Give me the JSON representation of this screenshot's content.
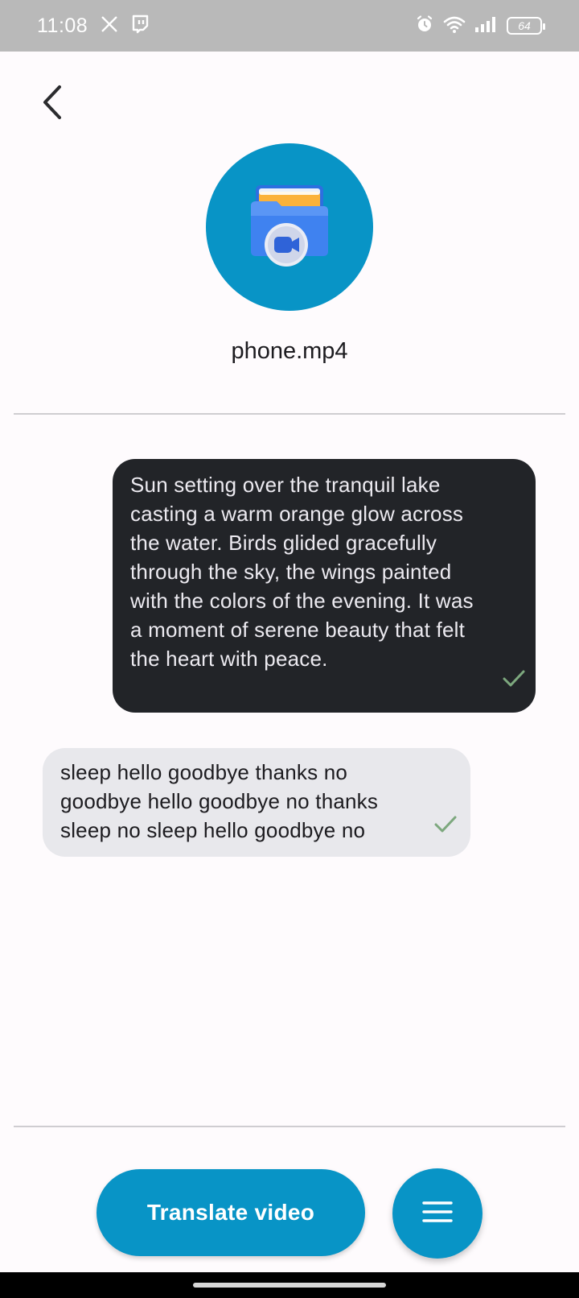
{
  "status_bar": {
    "time": "11:08",
    "battery": "64",
    "icons": [
      "x-icon",
      "twitch-icon",
      "alarm-icon",
      "wifi-icon",
      "signal-icon",
      "battery-icon"
    ]
  },
  "header": {
    "back_icon": "chevron-left-icon"
  },
  "file": {
    "name": "phone.mp4",
    "icon": "video-folder-icon"
  },
  "messages": [
    {
      "type": "source",
      "text": "Sun setting over the tranquil lake casting a warm orange glow across the water. Birds glided gracefully through the sky, the wings painted with the colors of the evening. It was a moment of serene beauty that felt the heart with peace.",
      "status_icon": "check-icon"
    },
    {
      "type": "translation",
      "text": "sleep hello goodbye thanks no goodbye hello goodbye no thanks sleep no sleep hello goodbye no",
      "status_icon": "check-icon"
    }
  ],
  "actions": {
    "translate_label": "Translate video",
    "menu_icon": "hamburger-menu-icon"
  },
  "colors": {
    "accent": "#0894c6",
    "dark_bubble": "#222428",
    "light_bubble": "#e8e8ec",
    "check": "#7da87e"
  }
}
